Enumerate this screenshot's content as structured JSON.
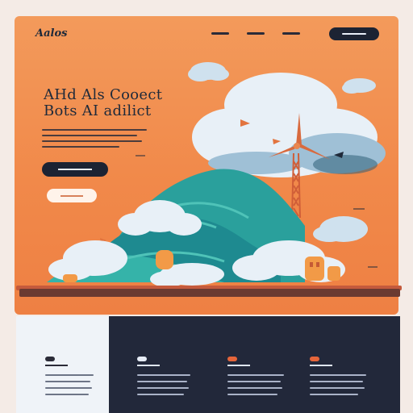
{
  "brand": {
    "name": "Aalos"
  },
  "hero": {
    "headline_line1": "AHd Als Cooect",
    "headline_line2": "Bots AI adilict"
  },
  "colors": {
    "hero_bg": "#f1894a",
    "dark": "#1c2333",
    "teal": "#2a9d9a",
    "cloud": "#e8f0f7",
    "footer": "#22283a"
  },
  "icons": [
    "wind-turbine-icon",
    "cloud-icon",
    "bird-icon",
    "fish-icon"
  ]
}
